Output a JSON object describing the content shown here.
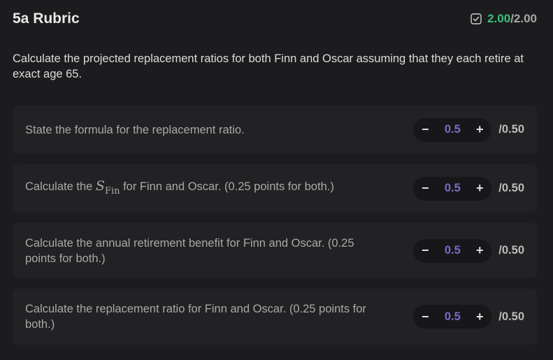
{
  "header": {
    "title": "5a Rubric",
    "score": "2.00",
    "total": "/2.00"
  },
  "description": "Calculate the projected replacement ratios for both Finn and Oscar assuming that they each retire at exact age 65.",
  "criteria": [
    {
      "text": "State the formula for the replacement ratio.",
      "value": "0.5",
      "max": "/0.50",
      "minus": "−",
      "plus": "+"
    },
    {
      "text_before": "Calculate the ",
      "math_symbol": "S",
      "math_sub": "Fin",
      "text_after": " for Finn and Oscar. (0.25 points for both.)",
      "value": "0.5",
      "max": "/0.50",
      "minus": "−",
      "plus": "+"
    },
    {
      "text": "Calculate the annual retirement benefit for Finn and Oscar. (0.25 points for both.)",
      "value": "0.5",
      "max": "/0.50",
      "minus": "−",
      "plus": "+"
    },
    {
      "text": "Calculate the replacement ratio for Finn and Oscar. (0.25 points for both.)",
      "value": "0.5",
      "max": "/0.50",
      "minus": "−",
      "plus": "+"
    }
  ],
  "colors": {
    "accent_green": "#39c07f",
    "value_purple": "#7b6cc6"
  }
}
